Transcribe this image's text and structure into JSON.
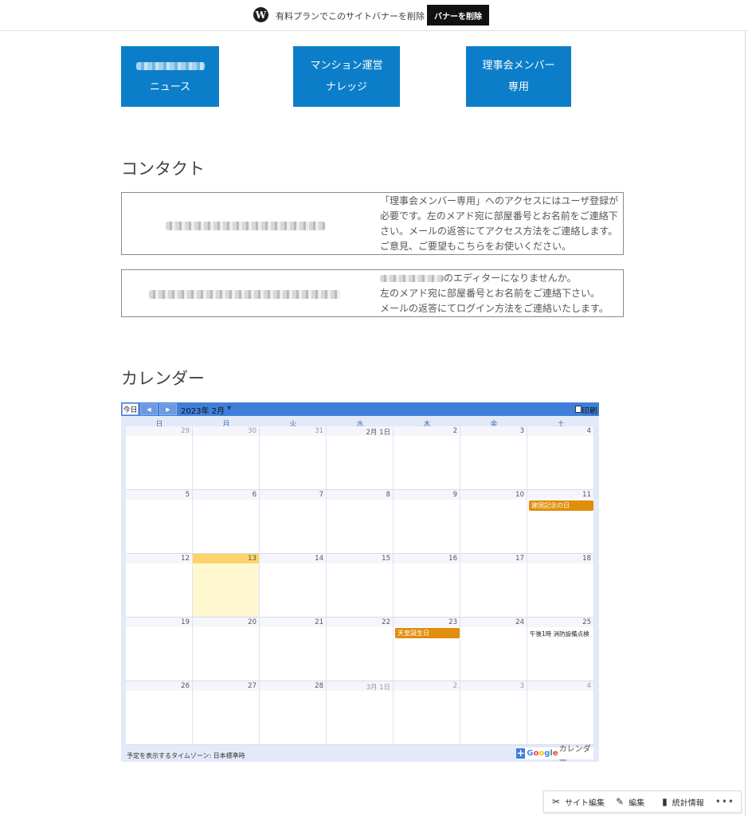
{
  "banner": {
    "text": "有料プランでこのサイトバナーを削除",
    "button": "バナーを削除"
  },
  "nav_tiles": [
    {
      "line2": "ニュース"
    },
    {
      "line1": "マンション運営",
      "line2": "ナレッジ"
    },
    {
      "line1": "理事会メンバー",
      "line2": "専用"
    }
  ],
  "contact": {
    "heading": "コンタクト",
    "box1_lines": [
      "「理事会メンバー専用」へのアクセスにはユーザ登録が",
      "必要です。左のメアド宛に部屋番号とお名前をご連絡下",
      "さい。メールの返答にてアクセス方法をご連絡します。",
      "ご意見、ご要望もこちらをお使いください。"
    ],
    "box2_line1_suffix": "のエディターになりませんか。",
    "box2_lines": [
      "左のメアド宛に部屋番号とお名前をご連絡下さい。",
      "メールの返答にてログイン方法をご連絡いたします。"
    ]
  },
  "calendar": {
    "heading": "カレンダー",
    "today_label": "今日",
    "month_label": "2023年 2月",
    "print_label": "印刷",
    "weekdays": [
      "日",
      "月",
      "火",
      "水",
      "木",
      "金",
      "土"
    ],
    "weeks": [
      [
        "29",
        "30",
        "31",
        "2月 1日",
        "2",
        "3",
        "4"
      ],
      [
        "5",
        "6",
        "7",
        "8",
        "9",
        "10",
        "11"
      ],
      [
        "12",
        "13",
        "14",
        "15",
        "16",
        "17",
        "18"
      ],
      [
        "19",
        "20",
        "21",
        "22",
        "23",
        "24",
        "25"
      ],
      [
        "26",
        "27",
        "28",
        "3月 1日",
        "2",
        "3",
        "4"
      ]
    ],
    "events": {
      "kenkoku": "建国記念の日",
      "tenno": "天皇誕生日",
      "shobo": "午後1時 消防設備点検"
    },
    "timezone": "予定を表示するタイムゾーン: 日本標準時",
    "google_word": "Google",
    "google_suffix": "カレンダー"
  },
  "actionbar": {
    "site_edit": "サイト編集",
    "edit": "編集",
    "stats": "統計情報",
    "more": "•••"
  },
  "colors": {
    "tile": "#0c7ec9",
    "cal_header": "#3f7fd9",
    "holiday": "#e08e0b",
    "today_bg": "#fff7cf"
  }
}
